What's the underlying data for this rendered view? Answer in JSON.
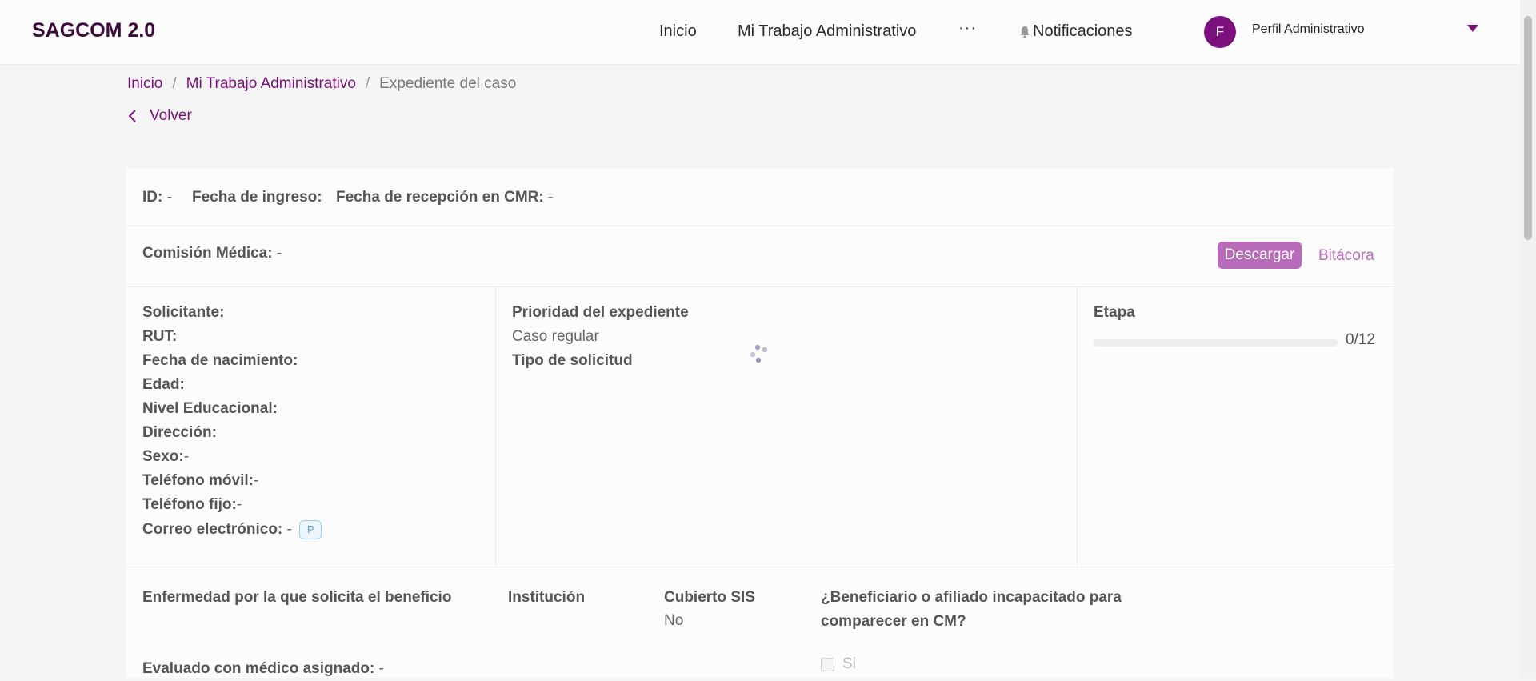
{
  "header": {
    "brand": "SAGCOM 2.0",
    "nav": [
      {
        "label": "Inicio"
      },
      {
        "label": "Mi Trabajo Administrativo"
      },
      {
        "label": "···"
      },
      {
        "label": "Notificaciones"
      }
    ],
    "avatar_initial": "F",
    "profile_name": "Perfil Administrativo"
  },
  "breadcrumb": {
    "items": [
      "Inicio",
      "Mi Trabajo Administrativo",
      "Expediente del caso"
    ],
    "separator": "/"
  },
  "back_label": "Volver",
  "case": {
    "id_label": "ID:",
    "id_value": " -",
    "entry_date_label": "Fecha de ingreso:",
    "cmr_date_label": "Fecha de recepción en CMR:",
    "cmr_date_value": " -",
    "commission_label": "Comisión Médica:",
    "commission_value": " -",
    "download_label": "Descargar",
    "log_label": "Bitácora"
  },
  "applicant": {
    "fields": [
      {
        "label": "Solicitante:",
        "value": ""
      },
      {
        "label": "RUT:",
        "value": ""
      },
      {
        "label": "Fecha de nacimiento:",
        "value": ""
      },
      {
        "label": "Edad:",
        "value": ""
      },
      {
        "label": "Nivel Educacional:",
        "value": ""
      },
      {
        "label": "Dirección:",
        "value": ""
      },
      {
        "label": "Sexo:",
        "value": "-"
      },
      {
        "label": "Teléfono móvil:",
        "value": "-"
      },
      {
        "label": "Teléfono fijo:",
        "value": "-"
      },
      {
        "label": "Correo electrónico:",
        "value": " - "
      }
    ],
    "email_badge": "P"
  },
  "priority": {
    "label": "Prioridad del expediente",
    "value": "Caso regular",
    "request_type_label": "Tipo de solicitud"
  },
  "stage": {
    "label": "Etapa",
    "progress_text": "0/12",
    "progress_fraction": 0
  },
  "details": {
    "disease_label": "Enfermedad por la que solicita el beneficio",
    "institution_label": "Institución",
    "sis_label": "Cubierto SIS",
    "sis_value": "No",
    "incapacitated_label_1": "¿Beneficiario o afiliado incapacitado para",
    "incapacitated_label_2": "comparecer en CM?",
    "incapacitated_option": "Si",
    "assigned_doctor_label": "Evaluado con médico asignado:",
    "assigned_doctor_value": " -"
  },
  "colors": {
    "brand_purple": "#7b0f7b",
    "accent_light_purple": "#b86bb8",
    "badge_blue": "#5aa0dd"
  }
}
